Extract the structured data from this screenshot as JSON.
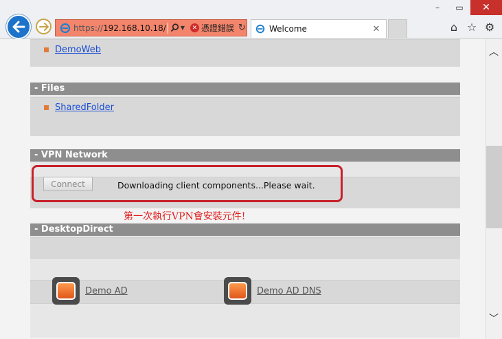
{
  "browser": {
    "address": {
      "scheme": "https://",
      "host": "192.168.10.18/",
      "cert_error": "憑證錯誤"
    },
    "tab": {
      "title": "Welcome"
    },
    "icons": [
      "back-icon",
      "forward-icon",
      "ie-icon",
      "search-icon",
      "refresh-icon",
      "home-icon",
      "favorites-icon",
      "settings-icon"
    ],
    "window_controls": {
      "minimize": "–",
      "maximize": "▭",
      "close": "✕"
    }
  },
  "sections": {
    "web": {
      "items": [
        {
          "label": "DemoWeb"
        }
      ]
    },
    "files": {
      "title": "- Files",
      "items": [
        {
          "label": "SharedFolder"
        }
      ]
    },
    "vpn": {
      "title": "- VPN Network",
      "connect_label": "Connect",
      "status": "Downloading client components...Please wait."
    },
    "desktop": {
      "title": "- DesktopDirect",
      "items": [
        {
          "label": "Demo AD"
        },
        {
          "label": "Demo AD DNS"
        }
      ]
    }
  },
  "annotation": "第一次執行VPN會安裝元件!",
  "colors": {
    "section_header": "#8e8e8e",
    "link": "#1a4ed4",
    "highlight": "#c8202a",
    "cert_error_bg": "#f3856c"
  }
}
